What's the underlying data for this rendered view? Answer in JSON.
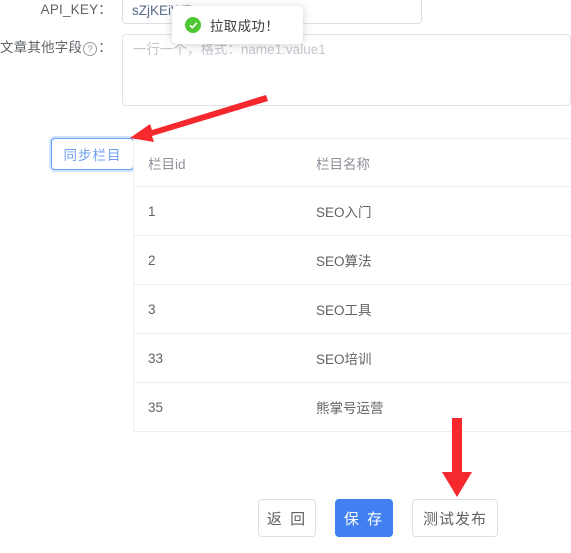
{
  "form": {
    "api_key": {
      "label": "API_KEY：",
      "value": "sZjKEiW7"
    },
    "extra_fields": {
      "label": "文章其他字段",
      "help_icon": "question-mark-circle-icon",
      "label_suffix": "：",
      "value": "",
      "placeholder": "一行一个，格式：name1:value1"
    }
  },
  "toast": {
    "icon": "success-check-circle-icon",
    "message": "拉取成功！",
    "icon_color": "#4fc734"
  },
  "sync_button": {
    "label": "同步栏目",
    "border_color": "#6aa1f7",
    "text_color": "#6d9ef5"
  },
  "table": {
    "columns": [
      "栏目id",
      "栏目名称"
    ],
    "rows": [
      {
        "id": "1",
        "name": "SEO入门"
      },
      {
        "id": "2",
        "name": "SEO算法"
      },
      {
        "id": "3",
        "name": "SEO工具"
      },
      {
        "id": "33",
        "name": "SEO培训"
      },
      {
        "id": "35",
        "name": "熊掌号运营"
      }
    ]
  },
  "footer": {
    "back_label": "返 回",
    "save_label": "保 存",
    "test_publish_label": "测试发布",
    "primary_color": "#4080f0"
  },
  "annotations": {
    "arrow_color": "#f5282d",
    "arrow_sync_target": "同步栏目",
    "arrow_publish_target": "测试发布"
  }
}
